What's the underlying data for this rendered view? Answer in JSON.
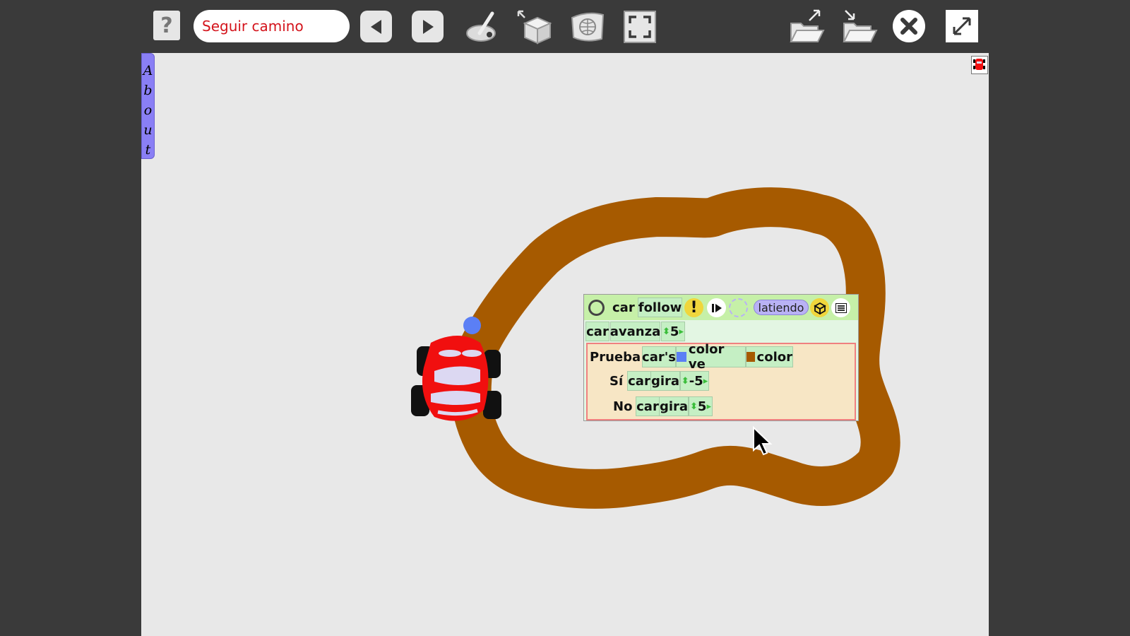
{
  "toolbar": {
    "help_label": "?",
    "project_name": "Seguir camino"
  },
  "flap": {
    "about_letters": [
      "A",
      "b",
      "o",
      "u",
      "t"
    ]
  },
  "script": {
    "player": "car",
    "name": "follow",
    "ticking_label": "latiendo",
    "forward_row": {
      "player": "car",
      "command": "avanza",
      "value": "5"
    },
    "test": {
      "label": "Prueba",
      "player_ref": "car's",
      "sees_label": "color ve",
      "color_label": "color",
      "swatch_color": "#5b7ff5",
      "target_color": "#a65a00",
      "yes": {
        "label": "Sí",
        "player": "car",
        "command": "gira",
        "value": "-5"
      },
      "no": {
        "label": "No",
        "player": "car",
        "command": "gira",
        "value": "5"
      }
    }
  },
  "colors": {
    "track": "#a65a00",
    "car_body": "#f10f0f",
    "window": "#dcd8f2",
    "pen_dot": "#5b7ff5",
    "world_bg": "#e8e8e8"
  }
}
